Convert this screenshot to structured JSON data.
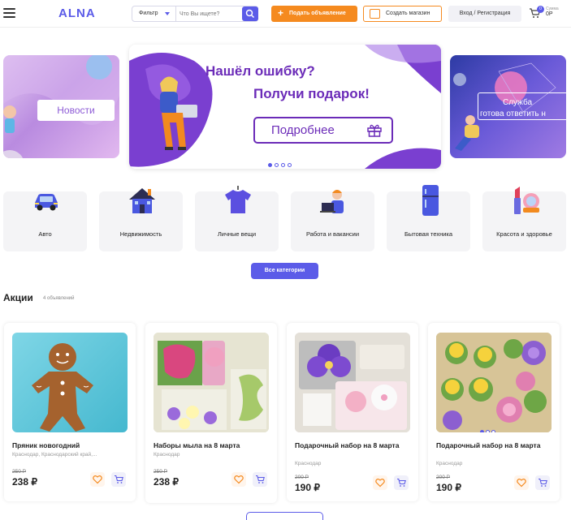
{
  "header": {
    "logo": "ALNA",
    "filter_label": "Фильтр",
    "search_placeholder": "Что Вы ищете?",
    "post_button": "Подать объявление",
    "shop_button": "Создать магазин",
    "login_button": "Вход / Регистрация",
    "cart_count": "0",
    "cart_sum_label": "Сумма",
    "cart_sum": "0Р"
  },
  "banners": {
    "left_button": "Новости",
    "center_title_1": "Нашёл ошибку?",
    "center_title_2": "Получи подарок!",
    "center_button": "Подробнее",
    "right_button_1": "Служба",
    "right_button_2": "готова ответить н",
    "dots_count": 4,
    "active_dot": 0
  },
  "categories": [
    {
      "label": "Авто",
      "icon": "car-icon"
    },
    {
      "label": "Недвижимость",
      "icon": "house-icon"
    },
    {
      "label": "Личные вещи",
      "icon": "tshirt-icon"
    },
    {
      "label": "Работа и вакансии",
      "icon": "worker-icon"
    },
    {
      "label": "Бытовая техника",
      "icon": "fridge-icon"
    },
    {
      "label": "Красота и здоровье",
      "icon": "cosmetics-icon"
    }
  ],
  "all_categories_button": "Все категории",
  "promo": {
    "title": "Акции",
    "count": "4 объявлений"
  },
  "products": [
    {
      "name": "Пряник новогодний",
      "location": "Краснодар, Краснодарский край,...",
      "old_price": "250 Р",
      "price": "238 ₽"
    },
    {
      "name": "Наборы мыла на 8 марта",
      "location": "Краснодар",
      "old_price": "250 Р",
      "price": "238 ₽"
    },
    {
      "name": "Подарочный набор на 8 марта",
      "location": "Краснодар",
      "old_price": "200 Р",
      "price": "190 ₽"
    },
    {
      "name": "Подарочный набор на 8 марта",
      "location": "Краснодар",
      "old_price": "200 Р",
      "price": "190 ₽"
    }
  ],
  "colors": {
    "accent": "#5b5be8",
    "orange": "#f58a1f",
    "purple": "#6b2bb8"
  }
}
